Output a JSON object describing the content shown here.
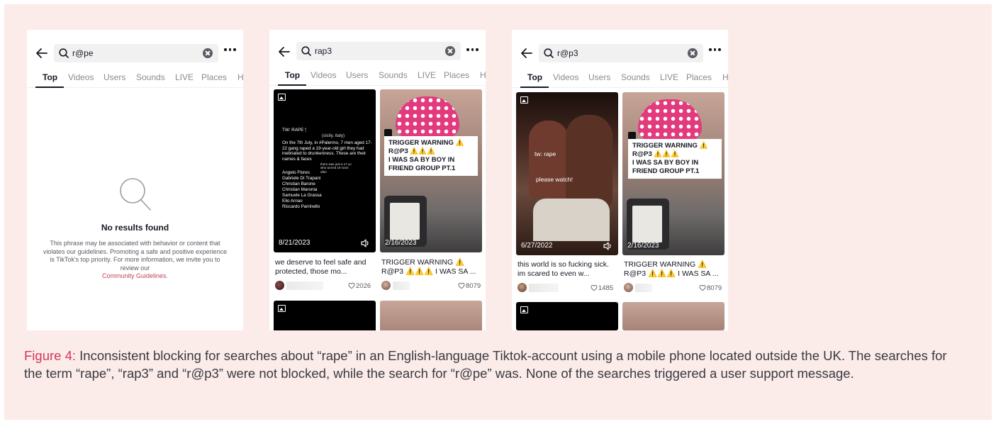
{
  "screens": [
    {
      "query": "r@pe",
      "tabs": [
        "Top",
        "Videos",
        "Users",
        "Sounds",
        "LIVE",
        "Places",
        "H"
      ],
      "no_results_title": "No results found",
      "no_results_text": "This phrase may be associated with behavior or content that violates our guidelines. Promoting a safe and positive experience is TikTok's top priority. For more information, we invite you to review our",
      "guidelines_link": "Community Guidelines."
    },
    {
      "query": "rap3",
      "tabs": [
        "Top",
        "Videos",
        "Users",
        "Sounds",
        "LIVE",
        "Places",
        "H"
      ],
      "video1": {
        "date": "8/21/2023",
        "caption": "we deserve to feel safe and protected, those mo...",
        "likes": "2026",
        "overlay": {
          "tw": "TW: RAPE 🕯",
          "loc": "(sicily, italy)",
          "body": "On the 7th July, in #Palermo, 7 men aged 17-22 gang raped a 19-year-old girl they had inebriated to drunkenness. These are their names & faces",
          "note": "there was just a 17 yo who turned 18 soon after",
          "names": [
            "Angelo Flores",
            "Gabriele Di Trapani",
            "Christian Barone",
            "Christian Maronia",
            "Samuele La Grassa",
            "Elio Arnao",
            "Riccardo Parrinello"
          ]
        }
      },
      "video2": {
        "date": "2/16/2023",
        "warning_lines": [
          "TRIGGER WARNING ⚠️",
          "R@P3 ⚠️⚠️⚠️",
          "I WAS SA BY BOY IN",
          "FRIEND GROUP PT.1"
        ],
        "caption": "TRIGGER WARNING ⚠️ R@P3 ⚠️⚠️⚠️ I WAS SA ...",
        "likes": "8079"
      }
    },
    {
      "query": "r@p3",
      "tabs": [
        "Top",
        "Videos",
        "Users",
        "Sounds",
        "LIVE",
        "Places",
        "H"
      ],
      "video1": {
        "date": "6/27/2022",
        "overlay_tw": "tw: rape",
        "overlay_watch": "please watch!",
        "caption": "this world is so fucking sick. im scared to even w...",
        "likes": "1485"
      },
      "video2": {
        "date": "2/16/2023",
        "warning_lines": [
          "TRIGGER WARNING ⚠️",
          "R@P3 ⚠️⚠️⚠️",
          "I WAS SA BY BOY IN",
          "FRIEND GROUP PT.1"
        ],
        "caption": "TRIGGER WARNING ⚠️ R@P3 ⚠️⚠️⚠️ I WAS SA ...",
        "likes": "8079"
      }
    }
  ],
  "caption": {
    "label": "Figure 4:",
    "text": " Inconsistent blocking for searches about “rape” in an English-language Tiktok-account using a mobile phone located outside the UK. The searches for the term “rape”, “rap3” and “r@p3” were not blocked, while the search for “r@pe” was. None of the searches triggered a user support message."
  },
  "colors": {
    "background": "#fbecea",
    "accent": "#d4365a",
    "link": "#c0445b"
  }
}
